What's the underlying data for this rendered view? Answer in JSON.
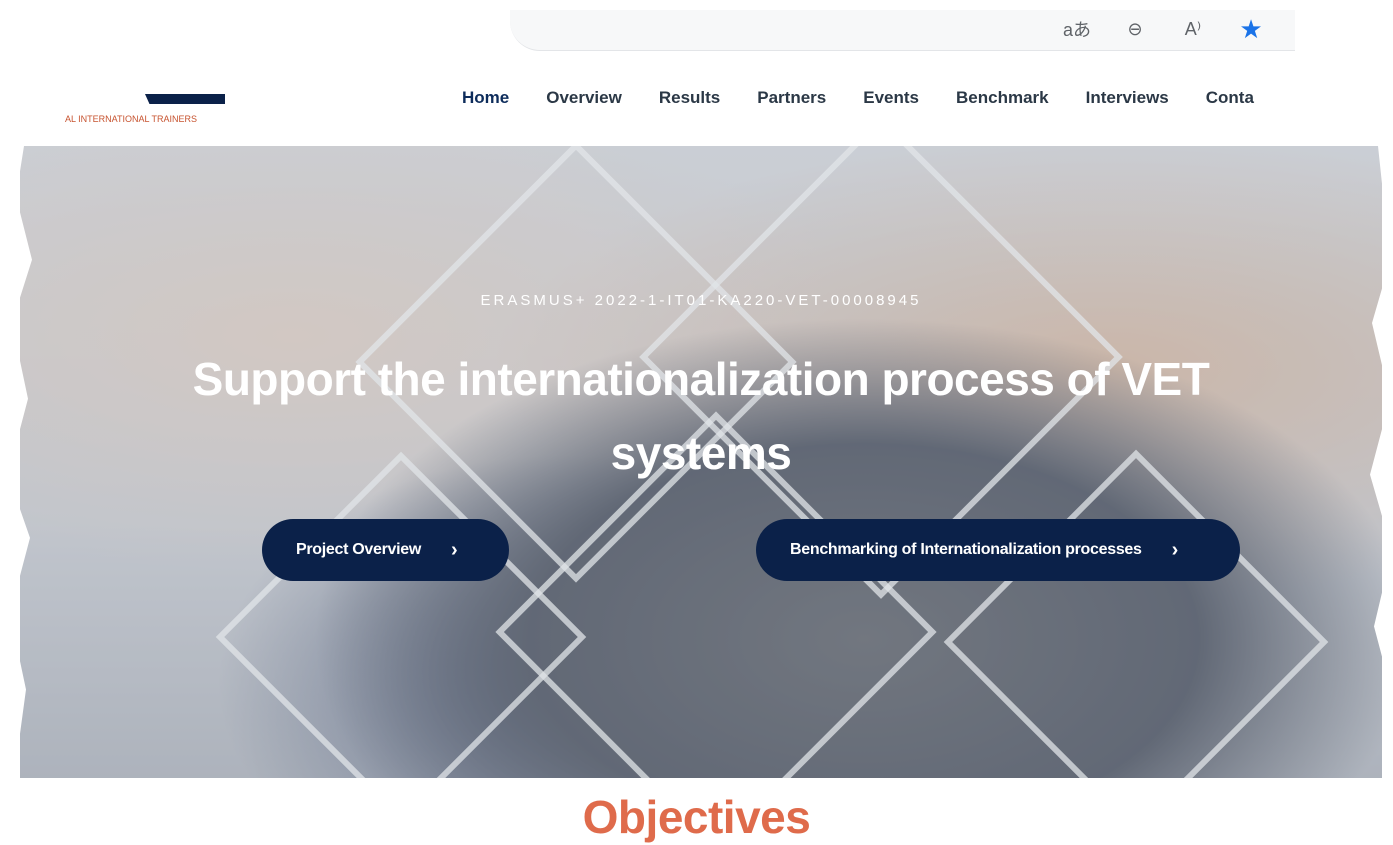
{
  "browser_toolbar": {
    "icons": [
      "translate-icon",
      "zoom-out-icon",
      "read-aloud-icon",
      "favorite-star-icon"
    ],
    "translate_glyph": "aあ",
    "zoom_glyph": "⊖",
    "read_aloud_glyph": "A⁾",
    "star_glyph": "★",
    "star_color": "#1a73e8"
  },
  "header": {
    "logo_text": "AL INTERNATIONAL TRAINERS",
    "nav": [
      {
        "label": "Home",
        "active": true
      },
      {
        "label": "Overview"
      },
      {
        "label": "Results"
      },
      {
        "label": "Partners"
      },
      {
        "label": "Events"
      },
      {
        "label": "Benchmark"
      },
      {
        "label": "Interviews"
      },
      {
        "label": "Conta"
      }
    ]
  },
  "hero": {
    "subtitle": "ERASMUS+ 2022-1-IT01-KA220-VET-00008945",
    "title": "Support the internationalization process of VET systems",
    "buttons": [
      {
        "label": "Project Overview",
        "icon": "chevron-right-icon"
      },
      {
        "label": "Benchmarking of Internationalization processes",
        "icon": "chevron-right-icon"
      }
    ],
    "chevron_glyph": "›"
  },
  "section": {
    "heading": "Objectives"
  },
  "colors": {
    "navy": "#0b2149",
    "accent_orange": "#df6b4b",
    "nav_text": "#2b3846"
  }
}
